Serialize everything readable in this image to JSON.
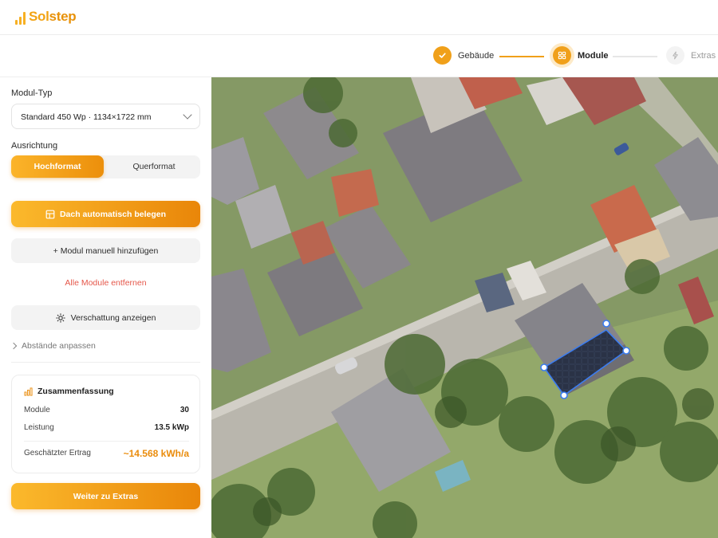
{
  "brand": {
    "name_part1": "Sol",
    "name_part2": "step",
    "icon": "bar-chart-logo-icon",
    "color": "#f0a01a"
  },
  "steps": [
    {
      "label": "Gebäude",
      "state": "done",
      "icon": "check-icon"
    },
    {
      "label": "Module",
      "state": "active",
      "icon": "grid-icon"
    },
    {
      "label": "Extras",
      "state": "todo",
      "icon": "bolt-icon"
    }
  ],
  "sidebar": {
    "module_type": {
      "label": "Modul-Typ",
      "selected": "Standard 450 Wp · 1134×1722 mm"
    },
    "orientation": {
      "label": "Ausrichtung",
      "options": [
        "Hochformat",
        "Querformat"
      ],
      "selected": "Hochformat"
    },
    "auto_fill_label": "Dach automatisch belegen",
    "add_manual_label": "+ Modul manuell hinzufügen",
    "remove_all_label": "Alle Module entfernen",
    "shading_label": "Verschattung anzeigen",
    "spacing_label": "Abstände anpassen",
    "summary": {
      "title": "Zusammenfassung",
      "rows": [
        {
          "label": "Module",
          "value": "30"
        },
        {
          "label": "Leistung",
          "value": "13.5 kWp"
        },
        {
          "label": "Geschätzter Ertrag",
          "value": "~14.568 kWh/a"
        }
      ]
    },
    "continue_label": "Weiter zu Extras"
  },
  "colors": {
    "accent": "#f0a01a",
    "accent_dark": "#e98609",
    "danger": "#e5574a",
    "selection": "#3b7cf0"
  }
}
